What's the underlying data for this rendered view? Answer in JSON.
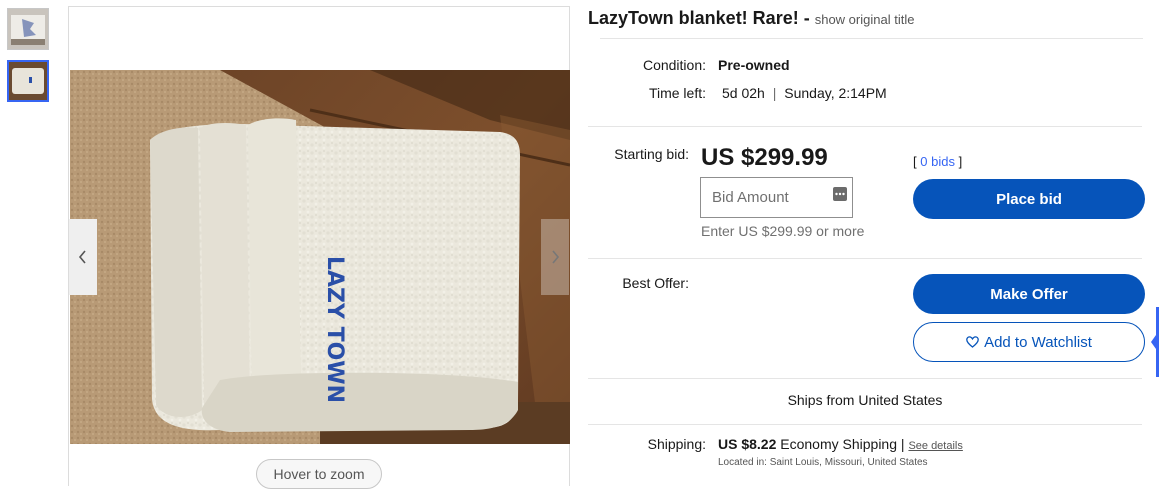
{
  "gallery": {
    "thumbnails": [
      {
        "alt": "LazyTown blanket thumbnail 1"
      },
      {
        "alt": "LazyTown blanket thumbnail 2",
        "selected": true
      }
    ],
    "main_image_alt": "Folded white fleece blanket with LazyTown logo",
    "logo_text": "LAZY TOWN",
    "hover_zoom_label": "Hover to zoom"
  },
  "listing": {
    "title": "LazyTown blanket! Rare! -",
    "show_original_label": "show original title",
    "condition_label": "Condition:",
    "condition_value": "Pre-owned",
    "time_left_label": "Time left:",
    "time_left_value": "5d 02h",
    "time_left_separator": "|",
    "end_time": "Sunday, 2:14PM"
  },
  "bidding": {
    "starting_bid_label": "Starting bid:",
    "price": "US $299.99",
    "bid_input_placeholder": "Bid Amount",
    "bid_hint": "Enter US $299.99 or more",
    "bids_open": "[",
    "bids_link": "0 bids",
    "bids_close": "]",
    "place_bid_label": "Place bid"
  },
  "offer": {
    "best_offer_label": "Best Offer:",
    "make_offer_label": "Make Offer",
    "watchlist_label": "Add to Watchlist"
  },
  "shipping": {
    "ships_from": "Ships from United States",
    "shipping_label": "Shipping:",
    "shipping_price": "US $8.22",
    "shipping_method": "Economy Shipping",
    "separator": "|",
    "see_details_label": "See details",
    "located_in": "Located in: Saint Louis, Missouri, United States"
  },
  "colors": {
    "primary_button": "#0654ba",
    "link": "#3665f3",
    "logo_blue": "#2a4fa8"
  },
  "icons": [
    "heart-icon",
    "chevron-left-icon",
    "chevron-right-icon",
    "keyboard-icon"
  ]
}
